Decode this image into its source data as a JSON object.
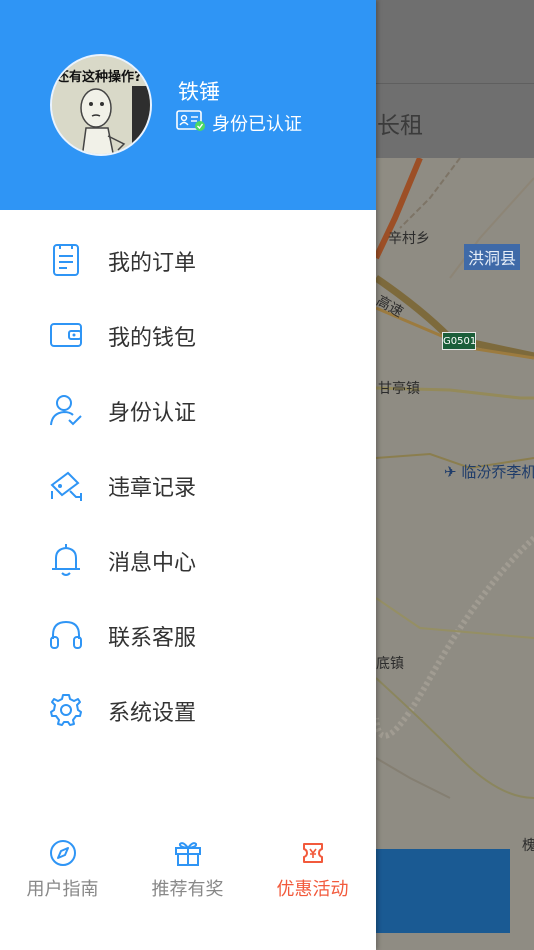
{
  "map": {
    "tab_label": "长租",
    "labels": [
      "辛村乡",
      "洪洞县",
      "甘亭镇",
      "临汾乔李机",
      "底镇",
      "槐"
    ],
    "road_label": "高速",
    "shield": "G0501"
  },
  "profile": {
    "avatar_caption": "还有这种操作?",
    "username": "铁锤",
    "verified_text": "身份已认证"
  },
  "menu": {
    "items": [
      {
        "label": "我的订单",
        "icon": "order-list-icon"
      },
      {
        "label": "我的钱包",
        "icon": "wallet-icon"
      },
      {
        "label": "身份认证",
        "icon": "identity-check-icon"
      },
      {
        "label": "违章记录",
        "icon": "traffic-camera-icon"
      },
      {
        "label": "消息中心",
        "icon": "bell-icon"
      },
      {
        "label": "联系客服",
        "icon": "headset-icon"
      },
      {
        "label": "系统设置",
        "icon": "gear-icon"
      }
    ]
  },
  "bottom": {
    "guide": "用户指南",
    "referral": "推荐有奖",
    "promo": "优惠活动"
  },
  "colors": {
    "primary": "#2f95f5",
    "accent": "#f25a3c",
    "menu_text": "#333333",
    "muted_text": "#888888"
  }
}
